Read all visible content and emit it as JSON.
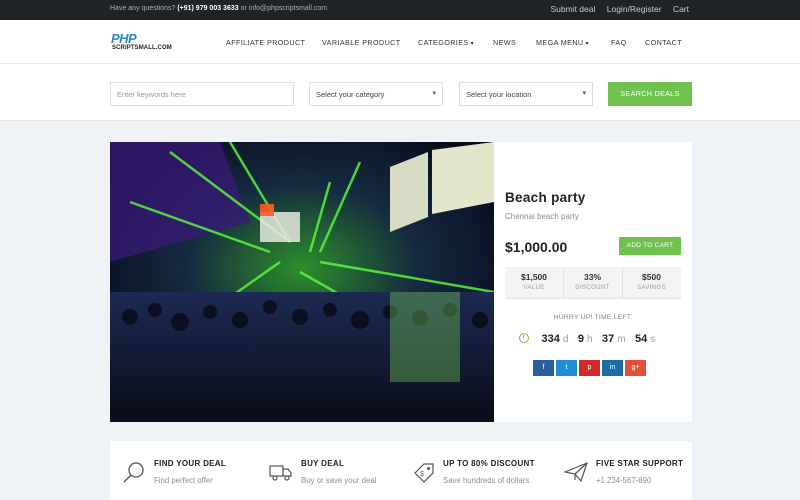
{
  "topbar": {
    "question": "Have any questions? ",
    "phone": "(+91) 979 003 3633",
    "or_text": " or ",
    "email": "info@phpscriptsmall.com",
    "submit_deal": "Submit deal",
    "login": "Login/Register",
    "cart": "Cart"
  },
  "logo": {
    "line1": "PHP",
    "line2": "SCRIPTSMALL.COM"
  },
  "nav": {
    "affiliate": "AFFILIATE PRODUCT",
    "variable": "VARIABLE PRODUCT",
    "categories": "CATEGORIES",
    "news": "NEWS",
    "mega": "MEGA MENU",
    "faq": "FAQ",
    "contact": "CONTACT"
  },
  "search": {
    "placeholder": "Enter keywords here",
    "category": "Select your category",
    "location": "Select your location",
    "button": "SEARCH DEALS"
  },
  "deal": {
    "title": "Beach party",
    "subtitle": "Chennai beach party",
    "price": "$1,000.00",
    "cart_button": "ADD TO CART",
    "stats": [
      {
        "value": "$1,500",
        "label": "VALUE"
      },
      {
        "value": "33%",
        "label": "DISCOUNT"
      },
      {
        "value": "$500",
        "label": "SAVINGS"
      }
    ],
    "hurry": "HURRY UP! TIME LEFT:",
    "timer": {
      "d": "334",
      "d_u": "d",
      "h": "9",
      "h_u": "h",
      "m": "37",
      "m_u": "m",
      "s": "54",
      "s_u": "s"
    },
    "social": {
      "fb": "f",
      "tw": "t",
      "pi": "p",
      "li": "in",
      "gp": "g+"
    }
  },
  "features": [
    {
      "title": "FIND YOUR DEAL",
      "sub": "Find perfect offer",
      "icon": "search-icon"
    },
    {
      "title": "BUY DEAL",
      "sub": "Buy or save your deal",
      "icon": "truck-icon"
    },
    {
      "title": "UP TO 80% DISCOUNT",
      "sub": "Save hundreds of dollars",
      "icon": "tag-icon"
    },
    {
      "title": "FIVE STAR SUPPORT",
      "sub": "+1 234-567-890",
      "icon": "paper-plane-icon"
    }
  ],
  "colors": {
    "accent": "#6fc24f",
    "topbar": "#1f2326",
    "logo_blue": "#2b89c9"
  }
}
